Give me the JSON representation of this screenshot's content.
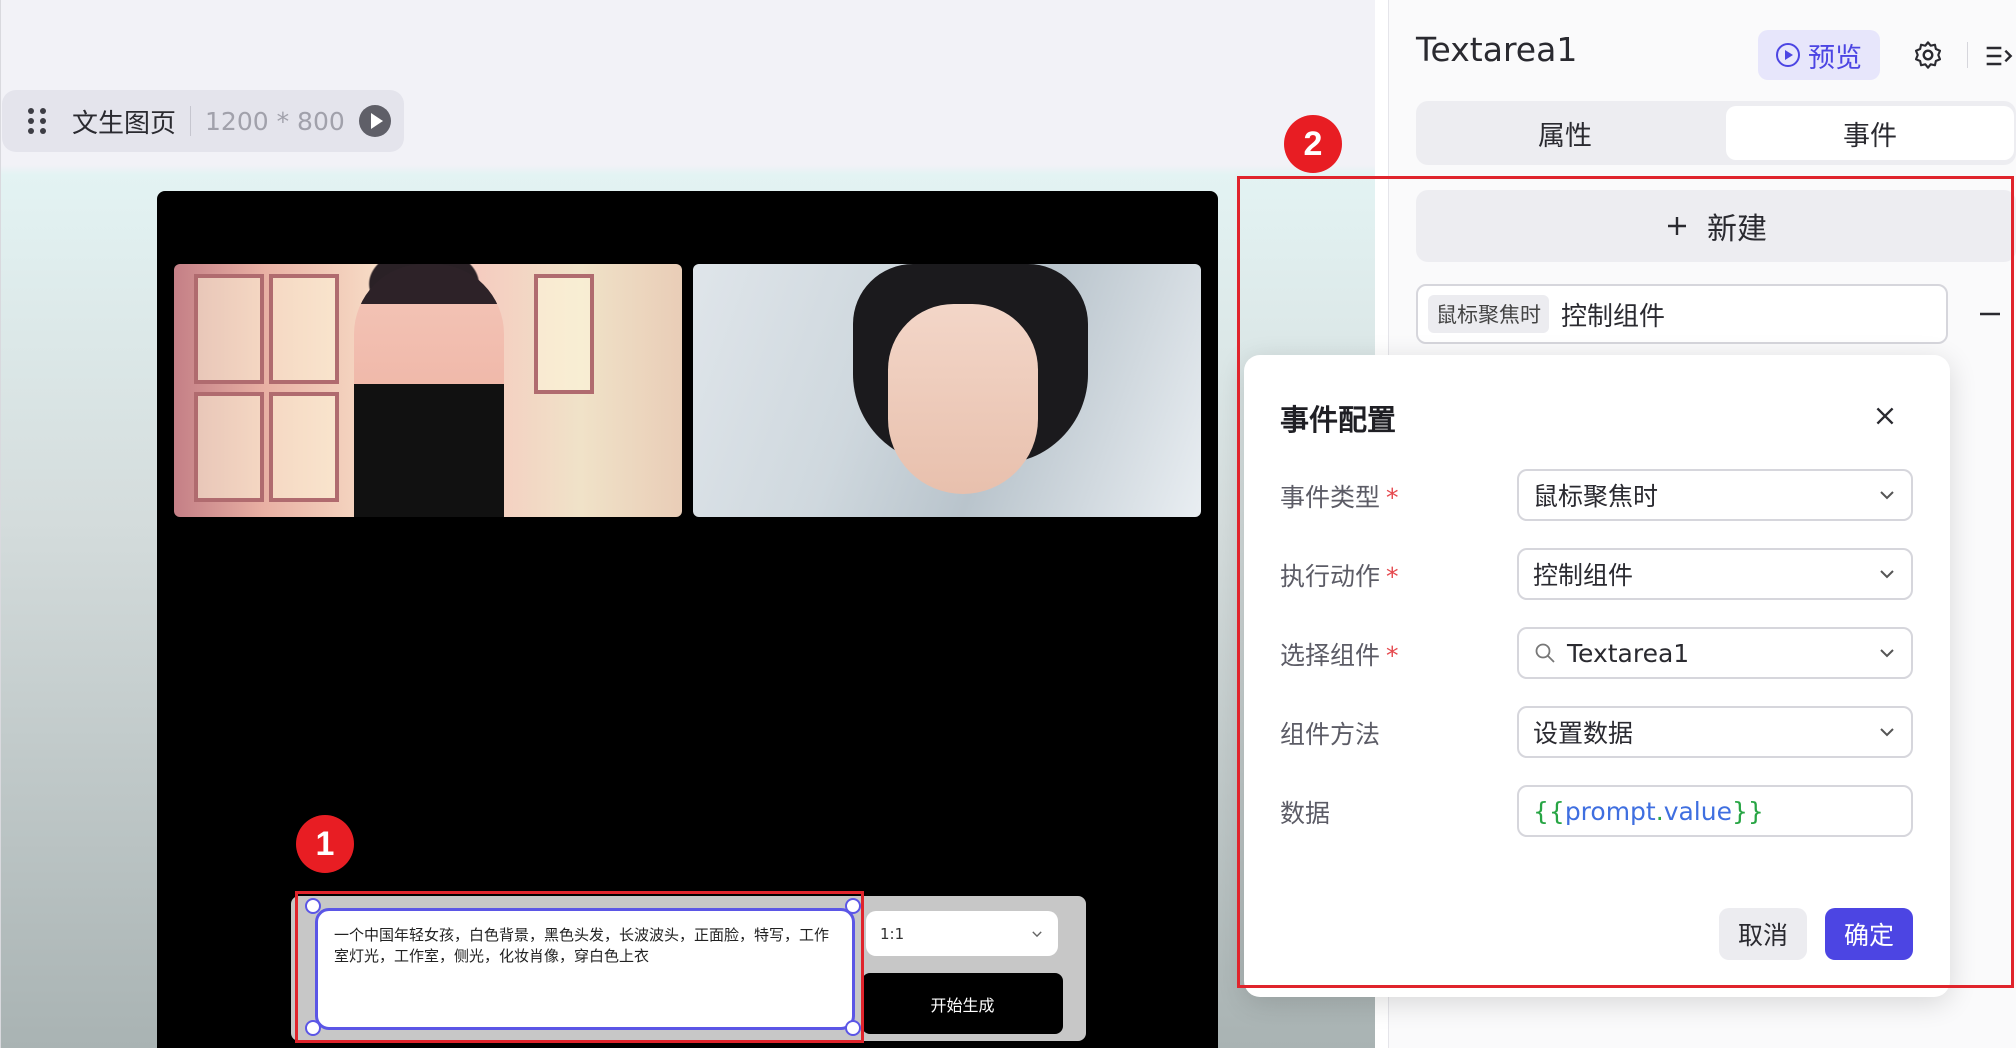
{
  "canvas": {
    "page_name": "文生图页",
    "page_size": "1200 * 800",
    "prompt_text": "一个中国年轻女孩，白色背景，黑色头发，长波波头，正面脸，特写，工作室灯光，工作室，侧光，化妆肖像，穿白色上衣",
    "ratio_value": "1:1",
    "generate_label": "开始生成"
  },
  "annotations": {
    "marker_1": "1",
    "marker_2": "2"
  },
  "panel": {
    "component_title": "Textarea1",
    "preview_label": "预览",
    "tabs": [
      {
        "label": "属性",
        "active": false
      },
      {
        "label": "事件",
        "active": true
      }
    ],
    "new_event_label": "新建",
    "event_item": {
      "trigger": "鼠标聚焦时",
      "action": "控制组件"
    }
  },
  "dialog": {
    "title": "事件配置",
    "fields": [
      {
        "label": "事件类型",
        "value": "鼠标聚焦时",
        "required": true
      },
      {
        "label": "执行动作",
        "value": "控制组件",
        "required": true
      },
      {
        "label": "选择组件",
        "value": "Textarea1",
        "required": true
      },
      {
        "label": "组件方法",
        "value": "设置数据",
        "required": false
      },
      {
        "label": "数据",
        "value": "{{prompt.value}}",
        "required": false
      }
    ],
    "data_parts": {
      "open": "{{",
      "var": "prompt",
      "dot": ".",
      "prop": "value",
      "close": "}}"
    },
    "required_mark": "*",
    "cancel_label": "取消",
    "confirm_label": "确定"
  },
  "colors": {
    "accent": "#4c45e3",
    "annotation_red": "#e81d23",
    "required": "#e5484d"
  },
  "icons": [
    "drag-handle-icon",
    "play-icon",
    "settings-icon",
    "collapse-panel-icon",
    "plus-icon",
    "minus-icon",
    "close-icon",
    "chevron-down-icon",
    "search-icon"
  ]
}
